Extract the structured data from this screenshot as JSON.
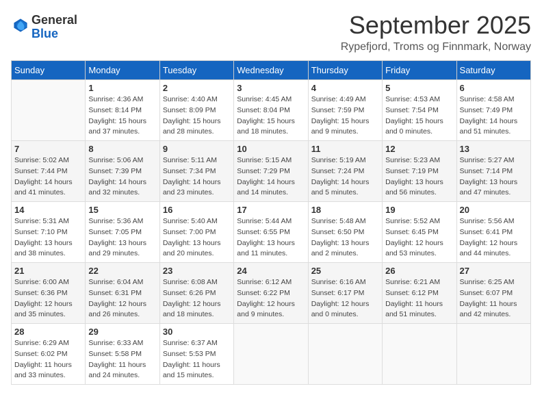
{
  "header": {
    "logo_line1": "General",
    "logo_line2": "Blue",
    "month": "September 2025",
    "location": "Rypefjord, Troms og Finnmark, Norway"
  },
  "weekdays": [
    "Sunday",
    "Monday",
    "Tuesday",
    "Wednesday",
    "Thursday",
    "Friday",
    "Saturday"
  ],
  "weeks": [
    [
      {
        "day": "",
        "info": ""
      },
      {
        "day": "1",
        "info": "Sunrise: 4:36 AM\nSunset: 8:14 PM\nDaylight: 15 hours\nand 37 minutes."
      },
      {
        "day": "2",
        "info": "Sunrise: 4:40 AM\nSunset: 8:09 PM\nDaylight: 15 hours\nand 28 minutes."
      },
      {
        "day": "3",
        "info": "Sunrise: 4:45 AM\nSunset: 8:04 PM\nDaylight: 15 hours\nand 18 minutes."
      },
      {
        "day": "4",
        "info": "Sunrise: 4:49 AM\nSunset: 7:59 PM\nDaylight: 15 hours\nand 9 minutes."
      },
      {
        "day": "5",
        "info": "Sunrise: 4:53 AM\nSunset: 7:54 PM\nDaylight: 15 hours\nand 0 minutes."
      },
      {
        "day": "6",
        "info": "Sunrise: 4:58 AM\nSunset: 7:49 PM\nDaylight: 14 hours\nand 51 minutes."
      }
    ],
    [
      {
        "day": "7",
        "info": "Sunrise: 5:02 AM\nSunset: 7:44 PM\nDaylight: 14 hours\nand 41 minutes."
      },
      {
        "day": "8",
        "info": "Sunrise: 5:06 AM\nSunset: 7:39 PM\nDaylight: 14 hours\nand 32 minutes."
      },
      {
        "day": "9",
        "info": "Sunrise: 5:11 AM\nSunset: 7:34 PM\nDaylight: 14 hours\nand 23 minutes."
      },
      {
        "day": "10",
        "info": "Sunrise: 5:15 AM\nSunset: 7:29 PM\nDaylight: 14 hours\nand 14 minutes."
      },
      {
        "day": "11",
        "info": "Sunrise: 5:19 AM\nSunset: 7:24 PM\nDaylight: 14 hours\nand 5 minutes."
      },
      {
        "day": "12",
        "info": "Sunrise: 5:23 AM\nSunset: 7:19 PM\nDaylight: 13 hours\nand 56 minutes."
      },
      {
        "day": "13",
        "info": "Sunrise: 5:27 AM\nSunset: 7:14 PM\nDaylight: 13 hours\nand 47 minutes."
      }
    ],
    [
      {
        "day": "14",
        "info": "Sunrise: 5:31 AM\nSunset: 7:10 PM\nDaylight: 13 hours\nand 38 minutes."
      },
      {
        "day": "15",
        "info": "Sunrise: 5:36 AM\nSunset: 7:05 PM\nDaylight: 13 hours\nand 29 minutes."
      },
      {
        "day": "16",
        "info": "Sunrise: 5:40 AM\nSunset: 7:00 PM\nDaylight: 13 hours\nand 20 minutes."
      },
      {
        "day": "17",
        "info": "Sunrise: 5:44 AM\nSunset: 6:55 PM\nDaylight: 13 hours\nand 11 minutes."
      },
      {
        "day": "18",
        "info": "Sunrise: 5:48 AM\nSunset: 6:50 PM\nDaylight: 13 hours\nand 2 minutes."
      },
      {
        "day": "19",
        "info": "Sunrise: 5:52 AM\nSunset: 6:45 PM\nDaylight: 12 hours\nand 53 minutes."
      },
      {
        "day": "20",
        "info": "Sunrise: 5:56 AM\nSunset: 6:41 PM\nDaylight: 12 hours\nand 44 minutes."
      }
    ],
    [
      {
        "day": "21",
        "info": "Sunrise: 6:00 AM\nSunset: 6:36 PM\nDaylight: 12 hours\nand 35 minutes."
      },
      {
        "day": "22",
        "info": "Sunrise: 6:04 AM\nSunset: 6:31 PM\nDaylight: 12 hours\nand 26 minutes."
      },
      {
        "day": "23",
        "info": "Sunrise: 6:08 AM\nSunset: 6:26 PM\nDaylight: 12 hours\nand 18 minutes."
      },
      {
        "day": "24",
        "info": "Sunrise: 6:12 AM\nSunset: 6:22 PM\nDaylight: 12 hours\nand 9 minutes."
      },
      {
        "day": "25",
        "info": "Sunrise: 6:16 AM\nSunset: 6:17 PM\nDaylight: 12 hours\nand 0 minutes."
      },
      {
        "day": "26",
        "info": "Sunrise: 6:21 AM\nSunset: 6:12 PM\nDaylight: 11 hours\nand 51 minutes."
      },
      {
        "day": "27",
        "info": "Sunrise: 6:25 AM\nSunset: 6:07 PM\nDaylight: 11 hours\nand 42 minutes."
      }
    ],
    [
      {
        "day": "28",
        "info": "Sunrise: 6:29 AM\nSunset: 6:02 PM\nDaylight: 11 hours\nand 33 minutes."
      },
      {
        "day": "29",
        "info": "Sunrise: 6:33 AM\nSunset: 5:58 PM\nDaylight: 11 hours\nand 24 minutes."
      },
      {
        "day": "30",
        "info": "Sunrise: 6:37 AM\nSunset: 5:53 PM\nDaylight: 11 hours\nand 15 minutes."
      },
      {
        "day": "",
        "info": ""
      },
      {
        "day": "",
        "info": ""
      },
      {
        "day": "",
        "info": ""
      },
      {
        "day": "",
        "info": ""
      }
    ]
  ]
}
